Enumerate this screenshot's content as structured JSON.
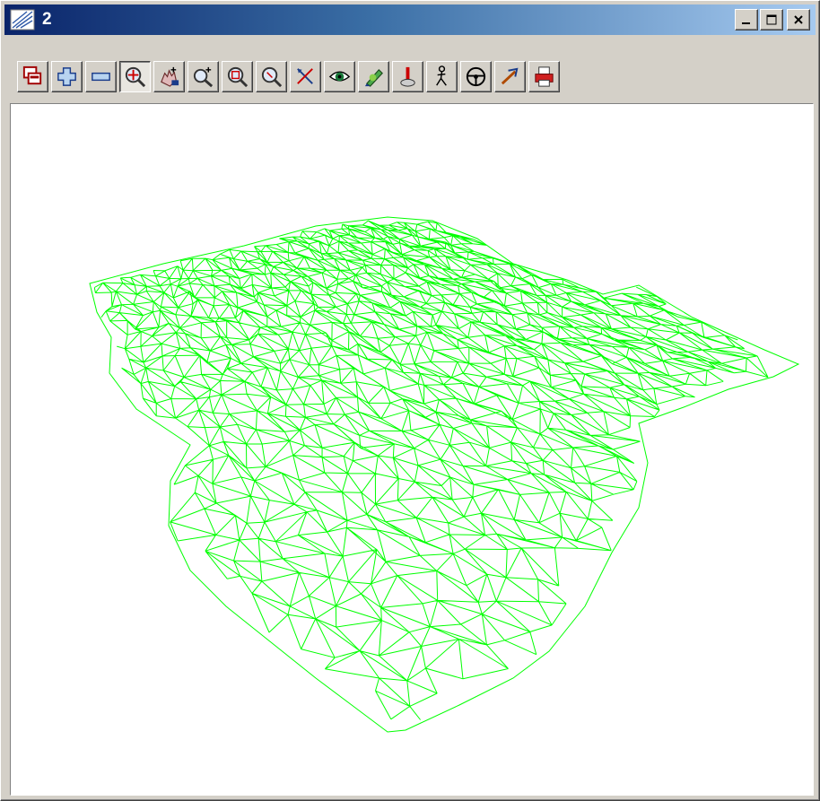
{
  "window": {
    "title": "2",
    "controls": [
      "minimize",
      "maximize",
      "close"
    ]
  },
  "toolbar": {
    "buttons": [
      {
        "name": "view-select-button",
        "icon": "views-icon"
      },
      {
        "name": "add-button",
        "icon": "plus-icon"
      },
      {
        "name": "remove-button",
        "icon": "minus-icon"
      },
      {
        "name": "zoom-extent-button",
        "icon": "zoom-extent-icon",
        "pressed": true
      },
      {
        "name": "pan-button",
        "icon": "hand-pan-icon"
      },
      {
        "name": "zoom-in-button",
        "icon": "zoom-in-icon"
      },
      {
        "name": "zoom-window-button",
        "icon": "zoom-window-icon"
      },
      {
        "name": "zoom-out-button",
        "icon": "zoom-out-icon"
      },
      {
        "name": "cursor-cross-button",
        "icon": "cross-cursor-icon"
      },
      {
        "name": "view-eye-button",
        "icon": "eye-icon"
      },
      {
        "name": "highlight-button",
        "icon": "pen-icon"
      },
      {
        "name": "probe-button",
        "icon": "probe-icon"
      },
      {
        "name": "walk-button",
        "icon": "walk-icon"
      },
      {
        "name": "drive-button",
        "icon": "steering-wheel-icon"
      },
      {
        "name": "pick-button",
        "icon": "pick-icon"
      },
      {
        "name": "print-button",
        "icon": "printer-icon"
      }
    ]
  },
  "view": {
    "mesh_color": "#00ff00",
    "background": "#ffffff"
  },
  "colors": {
    "title_start": "#0a246a",
    "title_end": "#a6caf0",
    "face": "#d4d0c8"
  }
}
